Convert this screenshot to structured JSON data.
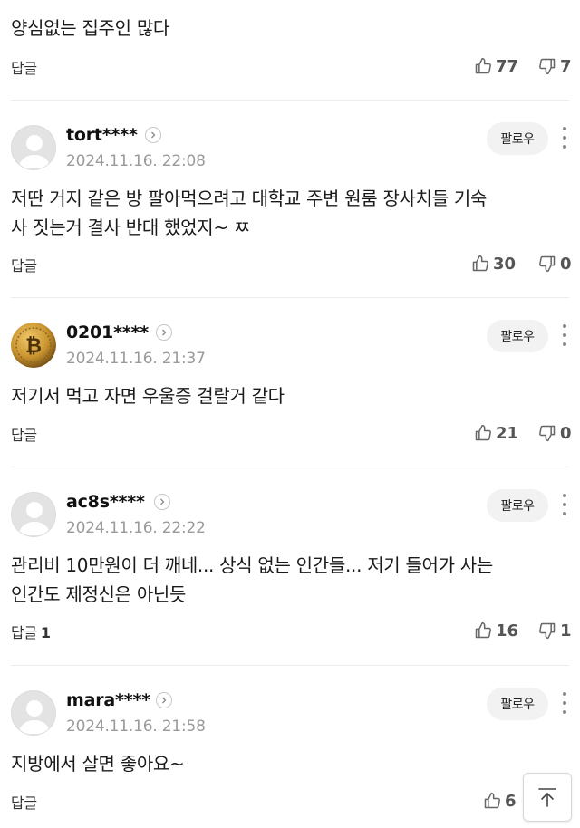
{
  "top_comment": {
    "text": "양심없는 집주인 많다",
    "reply_label": "답글",
    "likes": "77",
    "dislikes": "7"
  },
  "comments": [
    {
      "username": "tort****",
      "timestamp": "2024.11.16. 22:08",
      "follow_label": "팔로우",
      "text_lines": [
        "저딴 거지 같은 방 팔아먹으려고 대학교 주변 원룸 장사치들 기숙",
        "사 짓는거 결사 반대 했었지~ ㅉ"
      ],
      "reply_label": "답글",
      "reply_count": "",
      "likes": "30",
      "dislikes": "0",
      "avatar": "default-avatar"
    },
    {
      "username": "0201****",
      "timestamp": "2024.11.16. 21:37",
      "follow_label": "팔로우",
      "text_lines": [
        "저기서 먹고 자면 우울증 걸랄거 같다"
      ],
      "reply_label": "답글",
      "reply_count": "",
      "likes": "21",
      "dislikes": "0",
      "avatar": "bitcoin-avatar"
    },
    {
      "username": "ac8s****",
      "timestamp": "2024.11.16. 22:22",
      "follow_label": "팔로우",
      "text_lines": [
        "관리비 10만원이 더 깨네... 상식 없는 인간들... 저기 들어가 사는",
        "인간도 제정신은 아닌듯"
      ],
      "reply_label": "답글",
      "reply_count": "1",
      "likes": "16",
      "dislikes": "1",
      "avatar": "default-avatar"
    },
    {
      "username": "mara****",
      "timestamp": "2024.11.16. 21:58",
      "follow_label": "팔로우",
      "text_lines": [
        "지방에서 살면 좋아요~"
      ],
      "reply_label": "답글",
      "reply_count": "",
      "likes": "6",
      "dislikes": "",
      "avatar": "default-avatar"
    }
  ],
  "colors": {
    "text": "#1a1a1a",
    "muted": "#9a9a9a",
    "count": "#555555",
    "button_bg": "#f2f2f2",
    "divider": "#ececec",
    "bitcoin_gold": "#c9942f"
  },
  "icons": [
    "thumbs-up-icon",
    "thumbs-down-icon",
    "chevron-right-icon",
    "more-vertical-icon",
    "arrow-up-icon",
    "default-avatar-icon",
    "bitcoin-icon"
  ]
}
